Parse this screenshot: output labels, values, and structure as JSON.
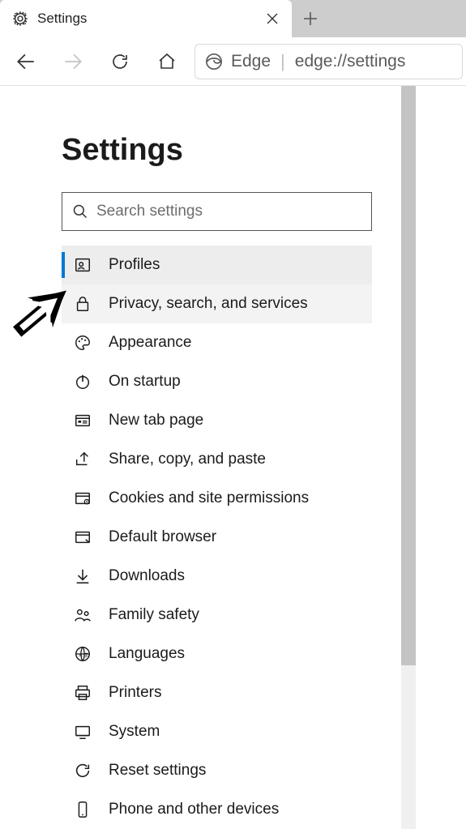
{
  "tab": {
    "title": "Settings"
  },
  "addressbar": {
    "brand": "Edge",
    "url": "edge://settings"
  },
  "page": {
    "title": "Settings"
  },
  "search": {
    "placeholder": "Search settings",
    "value": ""
  },
  "nav": {
    "items": [
      {
        "label": "Profiles",
        "icon": "profile",
        "state": "selected"
      },
      {
        "label": "Privacy, search, and services",
        "icon": "lock",
        "state": "hover"
      },
      {
        "label": "Appearance",
        "icon": "palette",
        "state": ""
      },
      {
        "label": "On startup",
        "icon": "power",
        "state": ""
      },
      {
        "label": "New tab page",
        "icon": "newtab",
        "state": ""
      },
      {
        "label": "Share, copy, and paste",
        "icon": "share",
        "state": ""
      },
      {
        "label": "Cookies and site permissions",
        "icon": "cookies",
        "state": ""
      },
      {
        "label": "Default browser",
        "icon": "browser",
        "state": ""
      },
      {
        "label": "Downloads",
        "icon": "download",
        "state": ""
      },
      {
        "label": "Family safety",
        "icon": "family",
        "state": ""
      },
      {
        "label": "Languages",
        "icon": "languages",
        "state": ""
      },
      {
        "label": "Printers",
        "icon": "printer",
        "state": ""
      },
      {
        "label": "System",
        "icon": "system",
        "state": ""
      },
      {
        "label": "Reset settings",
        "icon": "reset",
        "state": ""
      },
      {
        "label": "Phone and other devices",
        "icon": "phone",
        "state": ""
      }
    ]
  }
}
